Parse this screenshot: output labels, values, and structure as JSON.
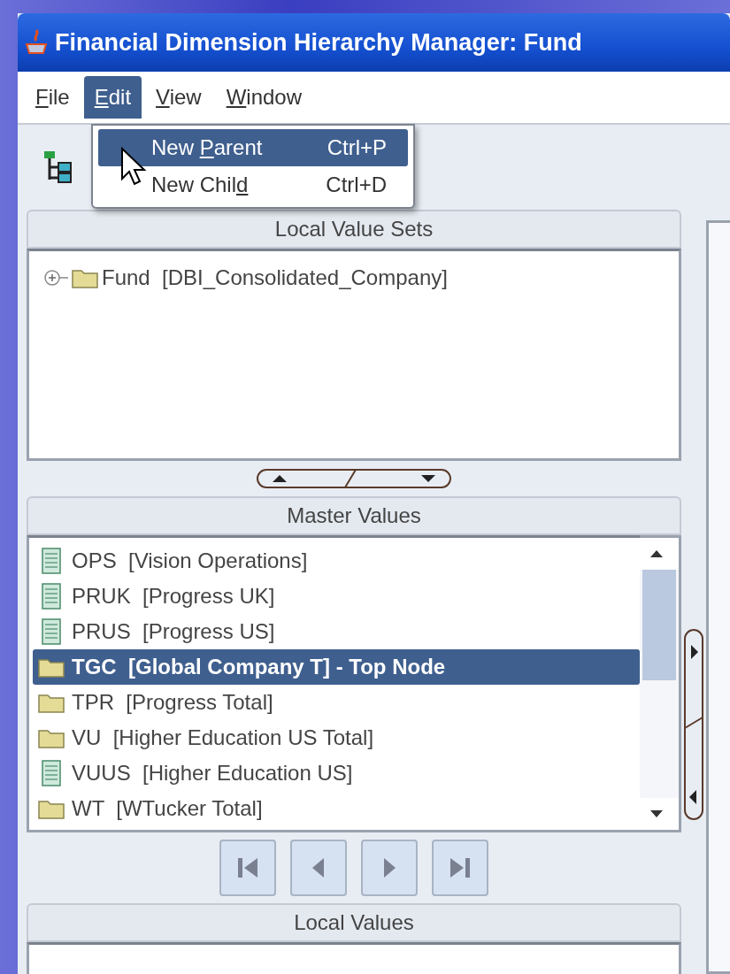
{
  "window": {
    "title": "Financial Dimension Hierarchy Manager: Fund"
  },
  "menu_bar": [
    {
      "key": "F",
      "after": "ile",
      "selected": false
    },
    {
      "key": "E",
      "after": "dit",
      "selected": true
    },
    {
      "key": "V",
      "after": "iew",
      "selected": false
    },
    {
      "key": "W",
      "after": "indow",
      "selected": false
    }
  ],
  "edit_menu": {
    "items": [
      {
        "before": "New ",
        "key": "P",
        "after": "arent",
        "shortcut": "Ctrl+P",
        "selected": true
      },
      {
        "before": "New Chil",
        "key": "d",
        "shortcut": "Ctrl+D",
        "selected": false
      }
    ]
  },
  "local_value_sets": {
    "title": "Local Value Sets",
    "tree": [
      {
        "label": "Fund  [DBI_Consolidated_Company]",
        "expanded": false
      }
    ]
  },
  "master_values": {
    "title": "Master Values",
    "items": [
      {
        "kind": "value",
        "label": "OPS  [Vision Operations]",
        "selected": false
      },
      {
        "kind": "value",
        "label": "PRUK  [Progress UK]",
        "selected": false
      },
      {
        "kind": "value",
        "label": "PRUS  [Progress US]",
        "selected": false
      },
      {
        "kind": "parent",
        "label": "TGC  [Global Company T] - Top Node",
        "selected": true
      },
      {
        "kind": "parent",
        "label": "TPR  [Progress Total]",
        "selected": false
      },
      {
        "kind": "parent",
        "label": "VU  [Higher Education US Total]",
        "selected": false
      },
      {
        "kind": "value",
        "label": "VUUS  [Higher Education US]",
        "selected": false
      },
      {
        "kind": "parent",
        "label": "WT  [WTucker Total]",
        "selected": false
      }
    ]
  },
  "local_values": {
    "title": "Local Values"
  }
}
